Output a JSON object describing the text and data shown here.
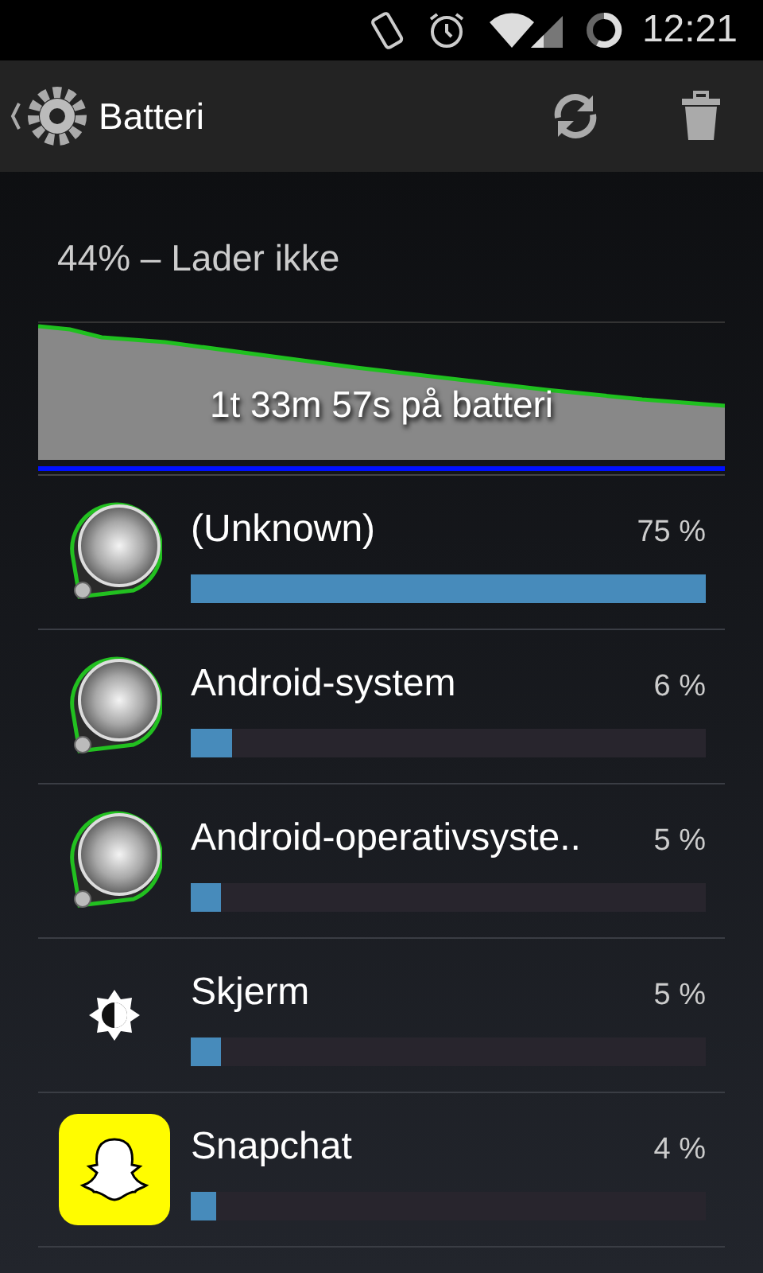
{
  "status_bar": {
    "time": "12:21"
  },
  "action_bar": {
    "title": "Batteri"
  },
  "summary": "44% – Lader ikke",
  "graph": {
    "label": "1t 33m 57s på batteri"
  },
  "apps": [
    {
      "name": "(Unknown)",
      "percent": "75 %",
      "level": 1.0,
      "kind": "android"
    },
    {
      "name": "Android-system",
      "percent": "6 %",
      "level": 0.08,
      "kind": "android"
    },
    {
      "name": "Android-operativsyste..",
      "percent": "5 %",
      "level": 0.06,
      "kind": "android"
    },
    {
      "name": "Skjerm",
      "percent": "5 %",
      "level": 0.06,
      "kind": "brightness"
    },
    {
      "name": "Snapchat",
      "percent": "4 %",
      "level": 0.05,
      "kind": "snapchat"
    }
  ]
}
